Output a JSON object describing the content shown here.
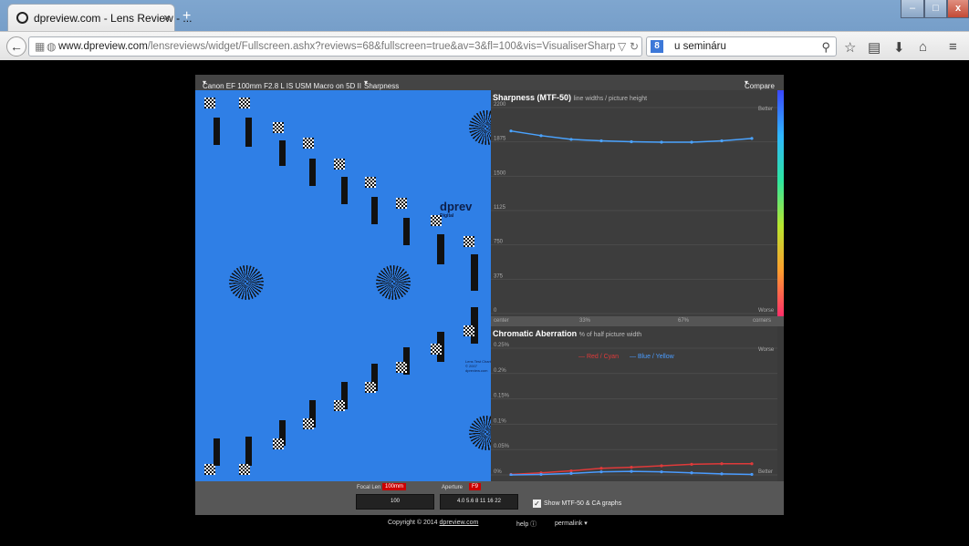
{
  "browser": {
    "tab_title": "dpreview.com - Lens Review - ...",
    "tab_close": "×",
    "new_tab": "+",
    "url_host": "www.dpreview.com",
    "url_rest": "/lensreviews/widget/Fullscreen.ashx?reviews=68&fullscreen=true&av=3&fl=100&vis=VisualiserSharpnessMTF&stac",
    "search_text": "u semináru",
    "window_minimize": "–",
    "window_maximize": "□",
    "window_close": "x"
  },
  "widget": {
    "lens_selector": "Canon EF 100mm F2.8 L IS USM Macro on 5D II",
    "mode_selector": "Sharpness",
    "compare": "Compare",
    "logo": "dprev",
    "logo_sub": "Digital",
    "chart_caption_1": "Lens Test Chart",
    "chart_caption_2": "© 2007 dpreview.com",
    "focal_label": "Focal Len",
    "focal_value": "100mm",
    "focal_slider": "100",
    "aperture_label": "Aperture",
    "aperture_value": "F9",
    "aperture_scale": "4.0 5.6 8 11 16 22",
    "show_label": "Show MTF-50 & CA graphs"
  },
  "footer": {
    "copyright": "Copyright © 2014",
    "copyright_link": "dpreview.com",
    "help": "help",
    "permalink": "permalink"
  },
  "chart_data": [
    {
      "type": "line",
      "title": "Sharpness (MTF-50)",
      "subtitle": "line widths / picture height",
      "y_ticks": [
        "2200",
        "1875",
        "1500",
        "1125",
        "750",
        "375",
        "0"
      ],
      "ylim": [
        0,
        2200
      ],
      "x_labels": [
        "center",
        "33%",
        "67%",
        "corners"
      ],
      "better_label": "Better",
      "worse_label": "Worse",
      "x": [
        0,
        1,
        2,
        3,
        4,
        5,
        6,
        7,
        8
      ],
      "series": [
        {
          "values": [
            1950,
            1900,
            1860,
            1845,
            1835,
            1830,
            1830,
            1845,
            1870
          ],
          "color": "#4aa3ff"
        }
      ]
    },
    {
      "type": "line",
      "title": "Chromatic Aberration",
      "subtitle": "% of half picture width",
      "y_ticks": [
        "0.25%",
        "0.2%",
        "0.15%",
        "0.1%",
        "0.05%",
        "0%"
      ],
      "ylim": [
        0,
        0.25
      ],
      "better_label": "Better",
      "worse_label": "Worse",
      "x": [
        0,
        1,
        2,
        3,
        4,
        5,
        6,
        7,
        8
      ],
      "series": [
        {
          "name": "Red / Cyan",
          "values": [
            0.001,
            0.004,
            0.008,
            0.013,
            0.015,
            0.018,
            0.021,
            0.022,
            0.022
          ],
          "color": "#e03a3a"
        },
        {
          "name": "Blue / Yellow",
          "values": [
            0.0,
            0.001,
            0.003,
            0.006,
            0.007,
            0.006,
            0.004,
            0.002,
            0.001
          ],
          "color": "#4a9cff"
        }
      ]
    }
  ]
}
